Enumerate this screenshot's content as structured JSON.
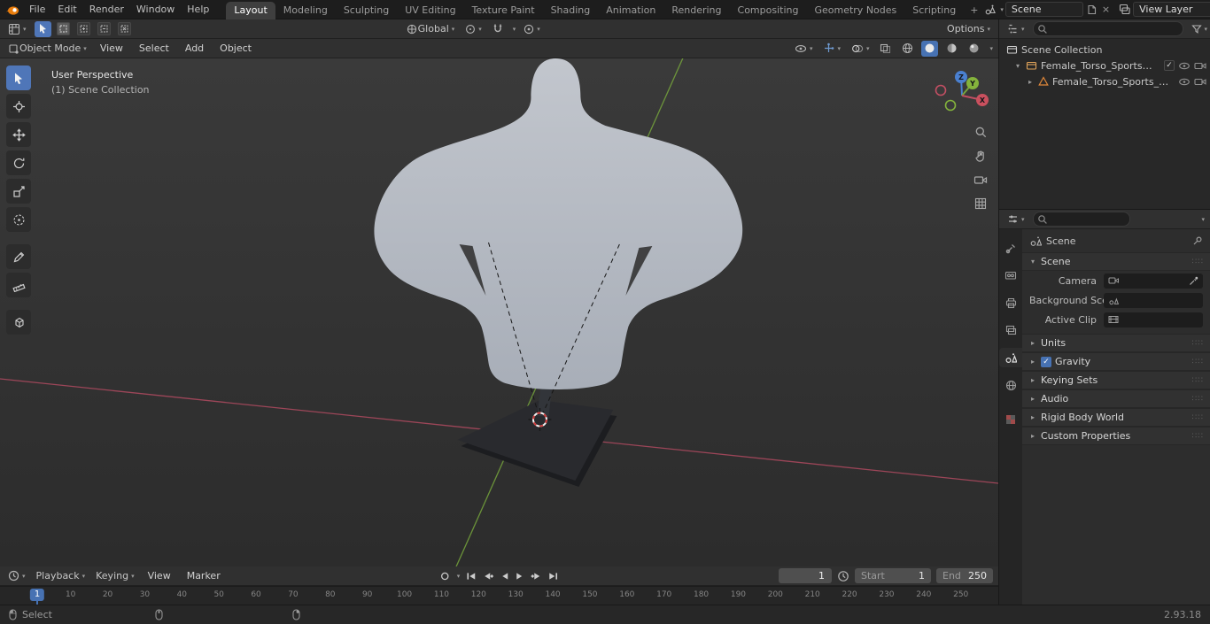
{
  "topbar": {
    "menus": [
      {
        "label": "File"
      },
      {
        "label": "Edit"
      },
      {
        "label": "Render"
      },
      {
        "label": "Window"
      },
      {
        "label": "Help"
      }
    ],
    "workspaces": [
      {
        "label": "Layout"
      },
      {
        "label": "Modeling"
      },
      {
        "label": "Sculpting"
      },
      {
        "label": "UV Editing"
      },
      {
        "label": "Texture Paint"
      },
      {
        "label": "Shading"
      },
      {
        "label": "Animation"
      },
      {
        "label": "Rendering"
      },
      {
        "label": "Compositing"
      },
      {
        "label": "Geometry Nodes"
      },
      {
        "label": "Scripting"
      }
    ],
    "add_tab": "+",
    "scene_value": "Scene",
    "view_layer_value": "View Layer"
  },
  "tool_header": {
    "orientation_value": "Global",
    "options_label": "Options"
  },
  "viewport_header": {
    "mode_value": "Object Mode",
    "menus": [
      {
        "label": "View"
      },
      {
        "label": "Select"
      },
      {
        "label": "Add"
      },
      {
        "label": "Object"
      }
    ]
  },
  "viewport": {
    "overlay_title": "User Perspective",
    "overlay_subtitle": "(1) Scene Collection",
    "axis_labels": {
      "x": "X",
      "y": "Y",
      "z": "Z"
    }
  },
  "outliner": {
    "root_label": "Scene Collection",
    "items": [
      {
        "label": "Female_Torso_Sports_Manne"
      },
      {
        "label": "Female_Torso_Sports_Ma"
      }
    ]
  },
  "properties": {
    "breadcrumb_value": "Scene",
    "scene_panel_title": "Scene",
    "fields": [
      {
        "label": "Camera"
      },
      {
        "label": "Background Scene"
      },
      {
        "label": "Active Clip"
      }
    ],
    "panels": [
      {
        "title": "Units"
      },
      {
        "title": "Gravity",
        "checked": true
      },
      {
        "title": "Keying Sets"
      },
      {
        "title": "Audio"
      },
      {
        "title": "Rigid Body World"
      },
      {
        "title": "Custom Properties"
      }
    ],
    "gravity_check": "✓"
  },
  "timeline": {
    "menus": [
      {
        "label": "Playback"
      },
      {
        "label": "Keying"
      },
      {
        "label": "View"
      },
      {
        "label": "Marker"
      }
    ],
    "current_frame": "1",
    "start_label": "Start",
    "start_value": "1",
    "end_label": "End",
    "end_value": "250",
    "marker_frame": "1",
    "ticks": [
      10,
      20,
      30,
      40,
      50,
      60,
      70,
      80,
      90,
      100,
      110,
      120,
      130,
      140,
      150,
      160,
      170,
      180,
      190,
      200,
      210,
      220,
      230,
      240,
      250
    ]
  },
  "statusbar": {
    "select_label": "Select",
    "version": "2.93.18"
  },
  "colors": {
    "accent": "#4772b3",
    "axis_x": "#b04a60",
    "axis_y": "#76a53c",
    "axis_z": "#4a80d0"
  }
}
